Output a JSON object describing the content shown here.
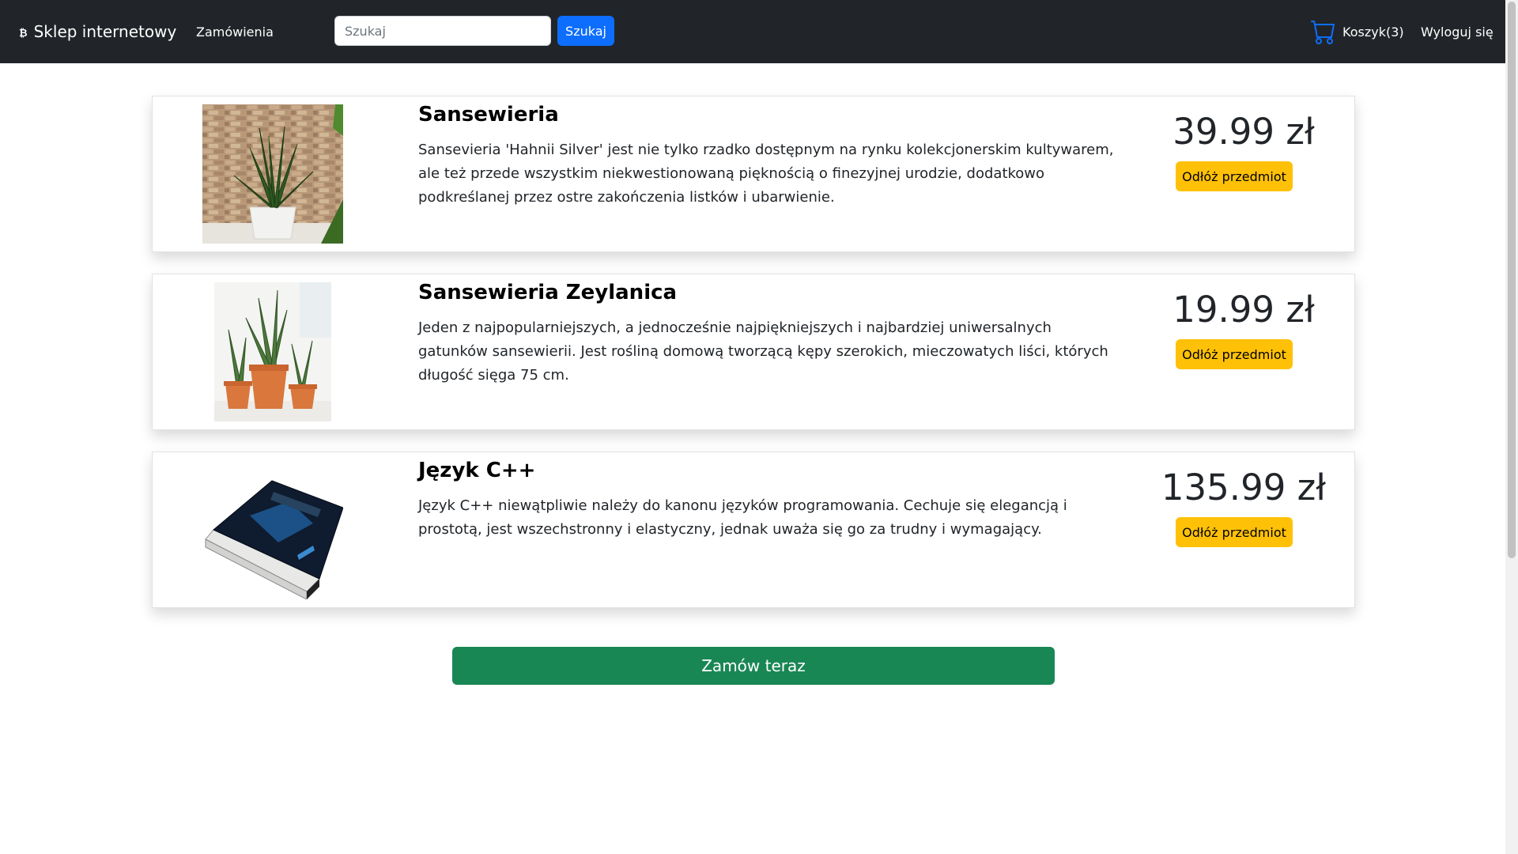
{
  "navbar": {
    "brand_icon": "₿",
    "brand": "Sklep internetowy",
    "orders": "Zamówienia",
    "search_placeholder": "Szukaj",
    "search_button": "Szukaj",
    "cart_icon": "cart-icon",
    "cart": "Koszyk(3)",
    "logout": "Wyloguj się"
  },
  "items": [
    {
      "title": "Sansewieria",
      "description": "Sansevieria 'Hahnii Silver' jest nie tylko rzadko dostępnym na rynku kolekcjonerskim kultywarem, ale też przede wszystkim niekwestionowaną pięknością o finezyjnej urodzie, dodatkowo podkreślanej przez ostre zakończenia listków i ubarwienie.",
      "price": "39.99 zł",
      "remove": "Odłóż przedmiot"
    },
    {
      "title": "Sansewieria Zeylanica",
      "description": "Jeden z najpopularniejszych, a jednocześnie najpiękniejszych i najbardziej uniwersalnych gatunków sansewierii. Jest rośliną domową tworzącą kępy szerokich, mieczowatych liści, których długość sięga 75 cm.",
      "price": "19.99 zł",
      "remove": "Odłóż przedmiot"
    },
    {
      "title": "Język C++",
      "description": "Język C++ niewątpliwie należy do kanonu języków programowania. Cechuje się elegancją i prostotą, jest wszechstronny i elastyczny, jednak uważa się go za trudny i wymagający.",
      "price": "135.99 zł",
      "remove": "Odłóż przedmiot"
    }
  ],
  "order_button": "Zamów teraz",
  "colors": {
    "navbar": "#212529",
    "primary": "#0d6efd",
    "warning": "#ffc107",
    "success": "#198754"
  }
}
